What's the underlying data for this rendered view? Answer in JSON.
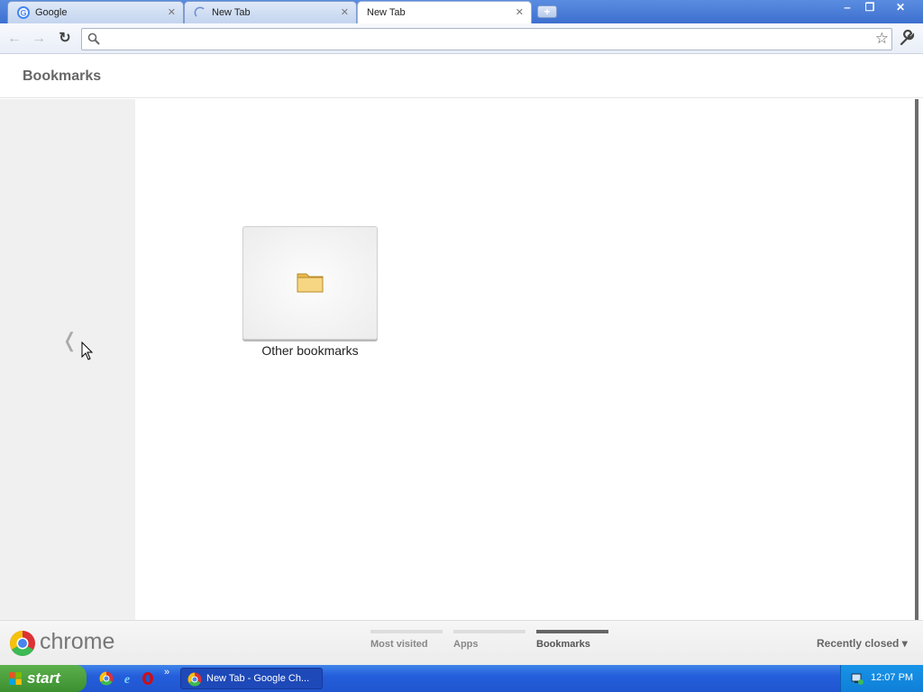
{
  "tabs": [
    {
      "label": "Google",
      "icon": "google-favicon"
    },
    {
      "label": "New Tab",
      "icon": "loading-spinner-icon"
    },
    {
      "label": "New Tab",
      "icon": "none"
    }
  ],
  "toolbar": {
    "omnibox_value": ""
  },
  "page": {
    "title": "Bookmarks",
    "tile_label": "Other bookmarks"
  },
  "footer": {
    "brand": "chrome",
    "tabs": [
      {
        "label": "Most visited",
        "active": false
      },
      {
        "label": "Apps",
        "active": false
      },
      {
        "label": "Bookmarks",
        "active": true
      }
    ],
    "recently_closed": "Recently closed"
  },
  "taskbar": {
    "start_label": "start",
    "quicklaunch_more": "»",
    "task_item": "New Tab - Google Ch...",
    "clock": "12:07 PM"
  },
  "colors": {
    "accent": "#3d6fcf",
    "taskbar": "#245edb",
    "start": "#3c8f2f"
  }
}
